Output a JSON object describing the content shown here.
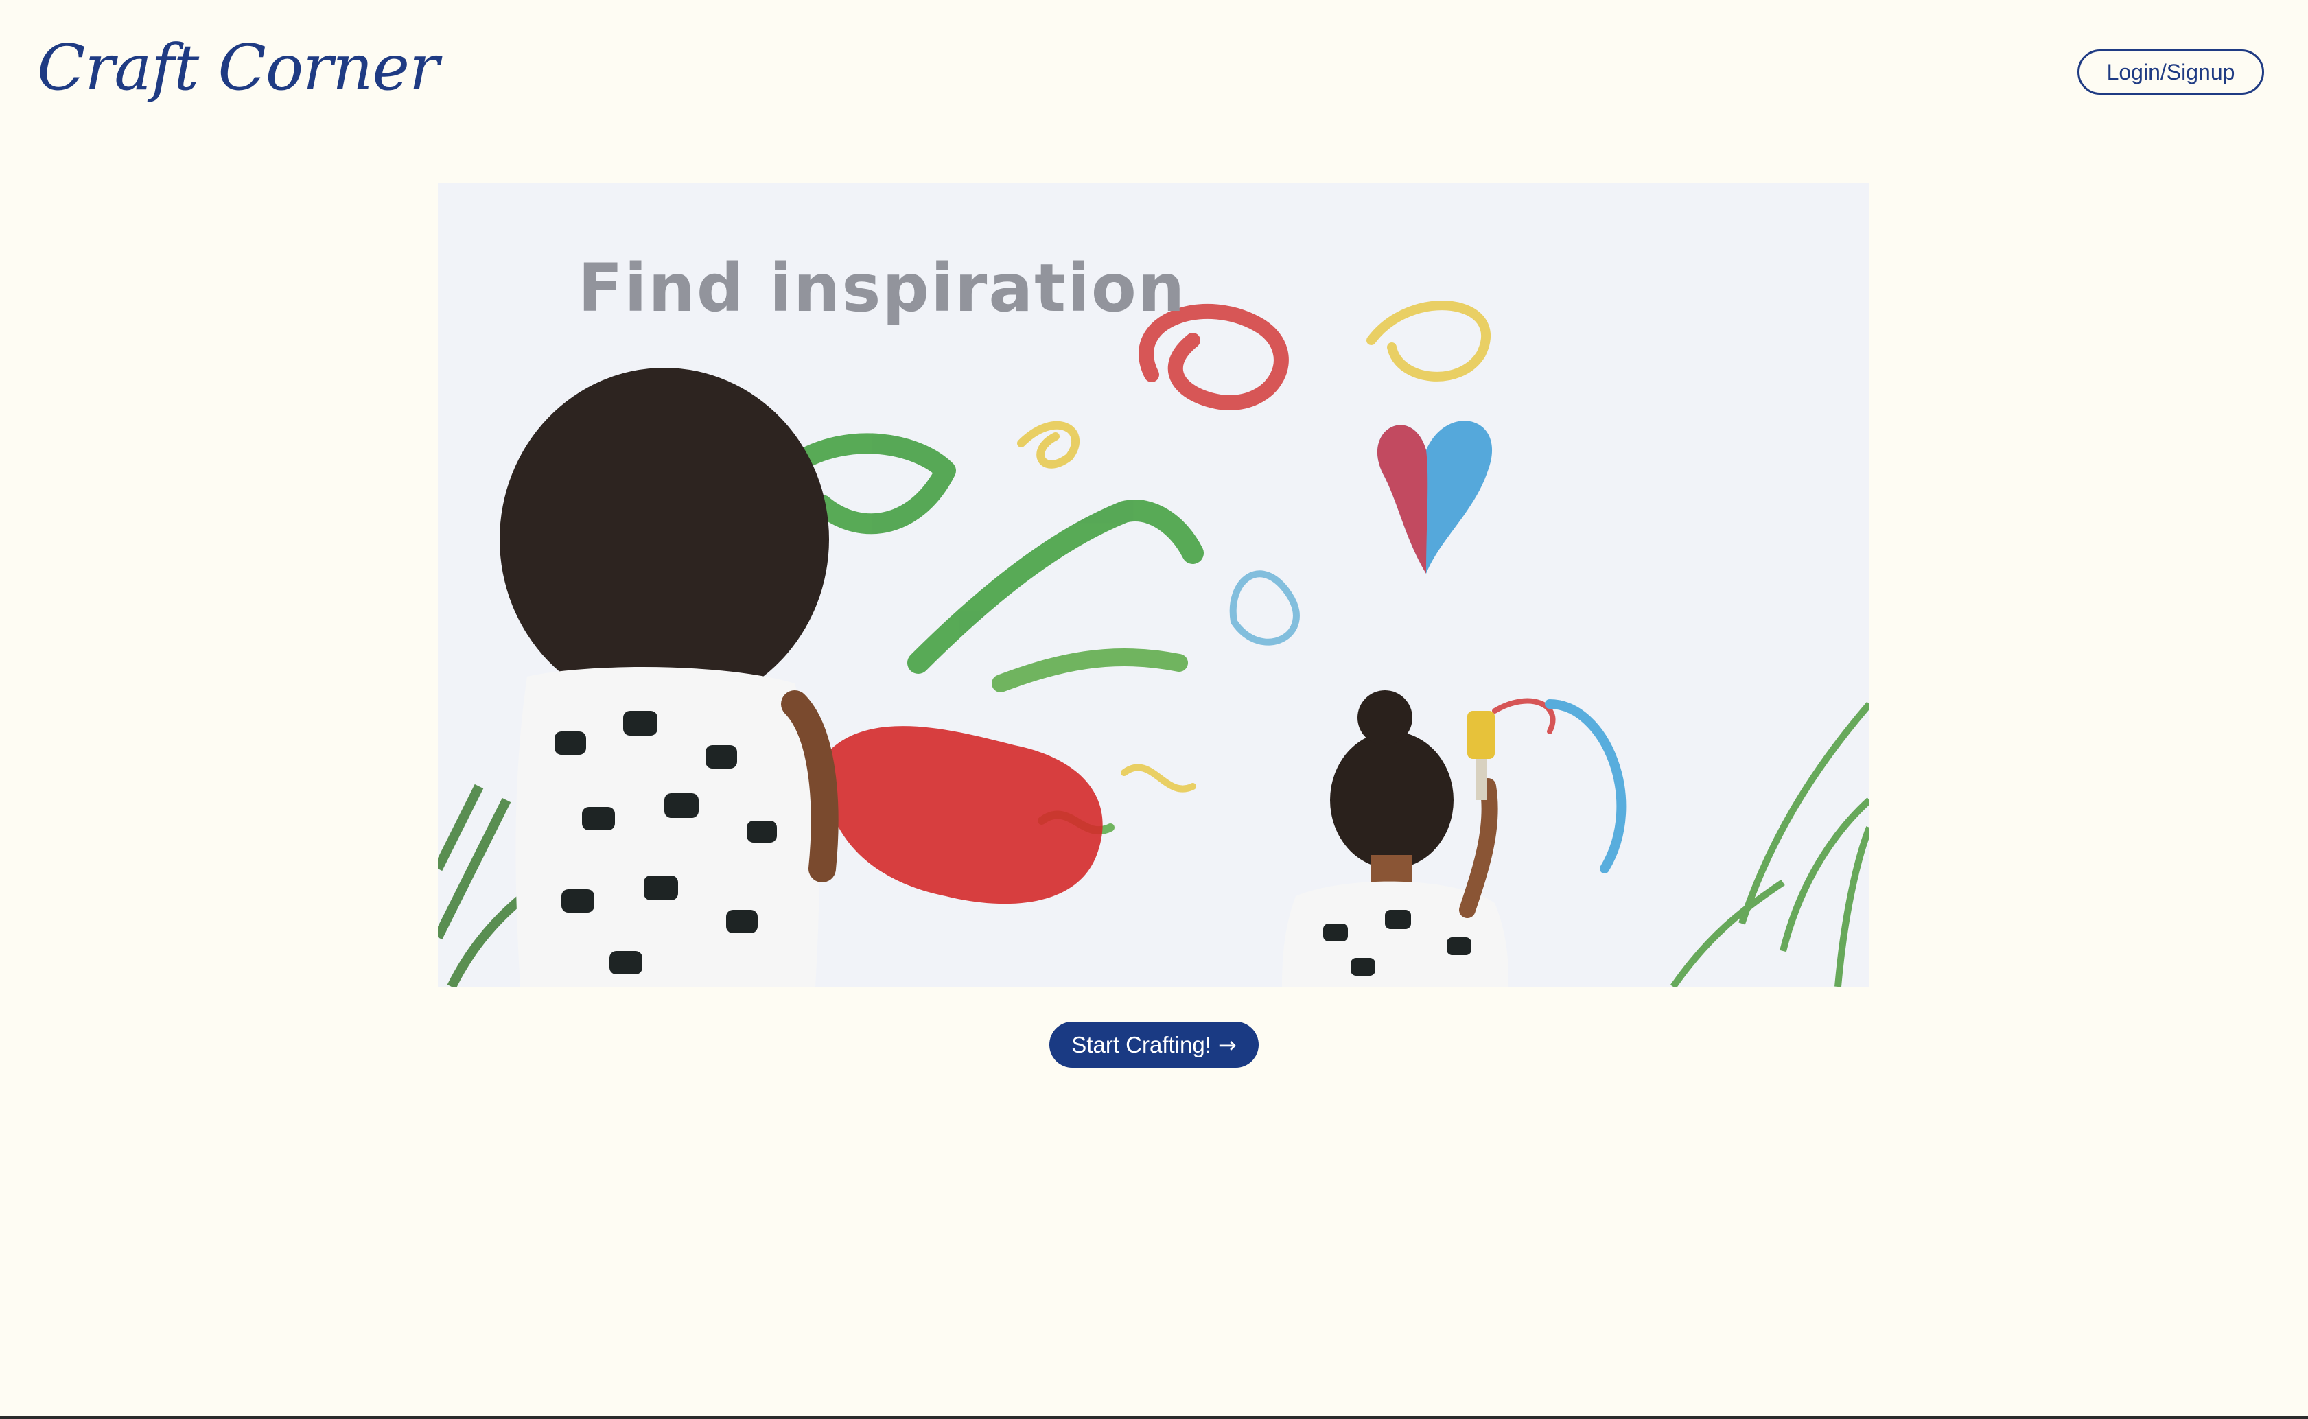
{
  "header": {
    "logo_text": "Craft Corner",
    "login_label": "Login/Signup"
  },
  "hero": {
    "caption": "Find inspiration"
  },
  "cta": {
    "label": "Start Crafting!",
    "arrow": "→"
  },
  "colors": {
    "background": "#fefcf3",
    "brand": "#1f3b83",
    "cta_background": "#1a3a83",
    "cta_text": "#ffffff"
  }
}
